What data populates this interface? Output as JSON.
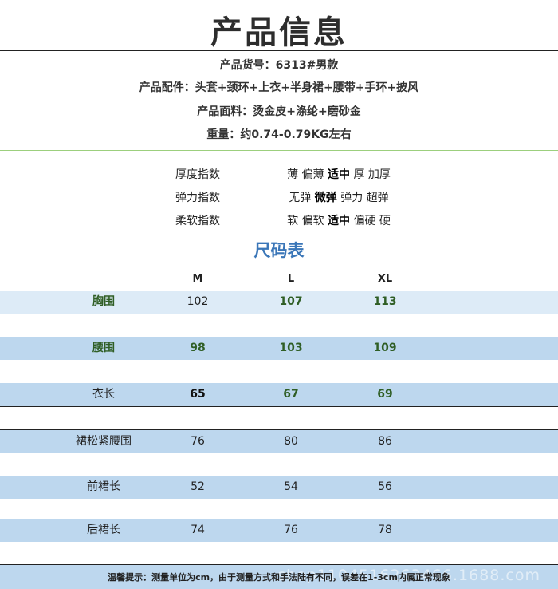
{
  "header": {
    "title": "产品信息"
  },
  "info": {
    "code": "产品货号：6313#男款",
    "accessories": "产品配件：头套+颈环+上衣+半身裙+腰带+手环+披风",
    "fabric": "产品面料：烫金皮+涤纶+磨砂金",
    "weight": "重量：约0.74-0.79KG左右"
  },
  "indices": [
    {
      "label": "厚度指数",
      "options": [
        "薄",
        "偏薄",
        "适中",
        "厚",
        "加厚"
      ],
      "selected": "适中"
    },
    {
      "label": "弹力指数",
      "options": [
        "无弹",
        "微弹",
        "弹力",
        "超弹"
      ],
      "selected": "微弹"
    },
    {
      "label": "柔软指数",
      "options": [
        "软",
        "偏软",
        "适中",
        "偏硬",
        "硬"
      ],
      "selected": "适中"
    }
  ],
  "size_table": {
    "title": "尺码表",
    "columns": [
      "M",
      "L",
      "XL"
    ],
    "rows": [
      {
        "label": "胸围",
        "values": [
          "102",
          "107",
          "113"
        ]
      },
      {
        "label": "腰围",
        "values": [
          "98",
          "103",
          "109"
        ]
      },
      {
        "label": "衣长",
        "values": [
          "65",
          "67",
          "69"
        ]
      },
      {
        "label": "裙松紧腰围",
        "values": [
          "76",
          "80",
          "86"
        ]
      },
      {
        "label": "前裙长",
        "values": [
          "52",
          "54",
          "56"
        ]
      },
      {
        "label": "后裙长",
        "values": [
          "74",
          "76",
          "78"
        ]
      }
    ]
  },
  "footer": {
    "note": "温馨提示：测量单位为cm，由于测量方式和手法陆有不同，误差在1-3cm内属正常现象",
    "watermark": "shop1104516263466.1688.com"
  },
  "colors": {
    "row_band": "#bdd7ee",
    "row_band_light": "#ddebf7",
    "size_title": "#3a76b8",
    "divider_green": "#9ccf7d",
    "label_green": "#2f5e25"
  }
}
